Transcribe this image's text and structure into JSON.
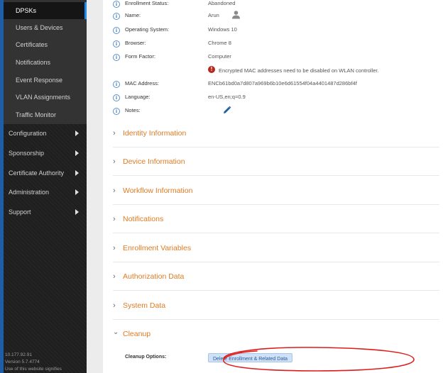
{
  "sidebar": {
    "sub_items": [
      {
        "label": "DPSKs",
        "active": true
      },
      {
        "label": "Users & Devices"
      },
      {
        "label": "Certificates"
      },
      {
        "label": "Notifications"
      },
      {
        "label": "Event Response"
      },
      {
        "label": "VLAN Assignments"
      },
      {
        "label": "Traffic Monitor"
      }
    ],
    "main_items": [
      {
        "label": "Configuration"
      },
      {
        "label": "Sponsorship"
      },
      {
        "label": "Certificate Authority"
      },
      {
        "label": "Administration"
      },
      {
        "label": "Support"
      }
    ],
    "footer": {
      "ip": "10.177.92.91",
      "version": "Version 5.7.4774",
      "notice": "Use of this website signifies"
    },
    "accent_color": "#1a8cf0"
  },
  "details": {
    "enrollment_status": {
      "label": "Enrollment Status:",
      "value": "Abandoned"
    },
    "name": {
      "label": "Name:",
      "value": "Arun"
    },
    "operating_system": {
      "label": "Operating System:",
      "value": "Windows 10"
    },
    "browser": {
      "label": "Browser:",
      "value": "Chrome 8"
    },
    "form_factor": {
      "label": "Form Factor:",
      "value": "Computer"
    },
    "warning": "Encrypted MAC addresses need to be disabled on WLAN controller.",
    "mac_address": {
      "label": "MAC Address:",
      "value": "ENCb61bd0a7d807a969b6b10e6d61554f04a4401487d286bf4f"
    },
    "language": {
      "label": "Language:",
      "value": "en-US,en;q=0.9"
    },
    "notes": {
      "label": "Notes:"
    }
  },
  "sections": [
    {
      "title": "Identity Information",
      "expanded": false
    },
    {
      "title": "Device Information",
      "expanded": false
    },
    {
      "title": "Workflow Information",
      "expanded": false
    },
    {
      "title": "Notifications",
      "expanded": false
    },
    {
      "title": "Enrollment Variables",
      "expanded": false
    },
    {
      "title": "Authorization Data",
      "expanded": false
    },
    {
      "title": "System Data",
      "expanded": false
    },
    {
      "title": "Cleanup",
      "expanded": true
    }
  ],
  "cleanup": {
    "options_label": "Cleanup Options:",
    "button_label": "Delete Enrollment & Related Data"
  },
  "colors": {
    "section_title": "#e07b22",
    "annotation": "#e01b1b"
  },
  "icons": {
    "info": "i",
    "warning": "!",
    "collapsed_chevron": "›",
    "expanded_chevron": "⌄"
  }
}
